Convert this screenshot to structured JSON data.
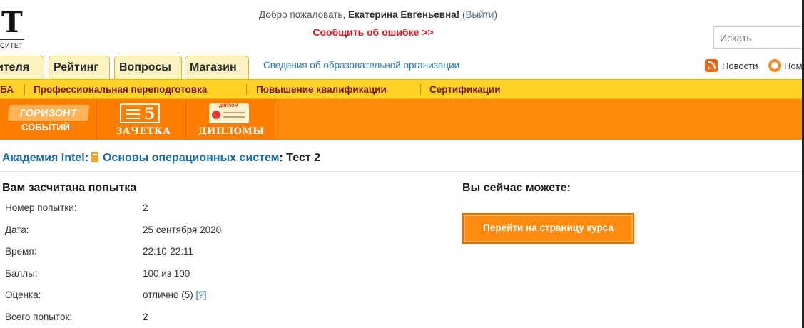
{
  "logo": {
    "letter": "T",
    "subtitle": "СИТЕТ"
  },
  "header": {
    "welcome_prefix": "Добро пожаловать, ",
    "user_name": "Екатерина Евгеньевна!",
    "logout_open": " (",
    "logout": "Выйти",
    "logout_close": ")",
    "report_error": "Сообщить об ошибке >>",
    "search_placeholder": "Искать"
  },
  "tabs": [
    {
      "label": "ителя"
    },
    {
      "label": "Рейтинг"
    },
    {
      "label": "Вопросы"
    },
    {
      "label": "Магазин"
    }
  ],
  "org_link": "Сведения об образовательной организации",
  "news_link": "Новости",
  "help_link": "Пом",
  "yellow_nav": [
    {
      "label": "БА"
    },
    {
      "label": "Профессиональная переподготовка"
    },
    {
      "label": "Повышение квалификации"
    },
    {
      "label": "Сертификации"
    }
  ],
  "banner": {
    "horizon_top": "ГОРИЗОНТ",
    "horizon_bottom": "СОБЫТИЙ",
    "zachetka_num": "5",
    "zachetka_label": "ЗАЧЕТКА",
    "diploma_icon_text": "ДИПЛОМ",
    "diplomas_label": "ДИПЛОМЫ"
  },
  "breadcrumb": {
    "academy": "Академия Intel",
    "sep1": ":",
    "course": "Основы операционных систем",
    "sep2": ":",
    "test": " Тест 2"
  },
  "result": {
    "title": "Вам засчитана попытка",
    "rows": [
      {
        "label": "Номер попытки:",
        "value": "2"
      },
      {
        "label": "Дата:",
        "value": "25 сентября 2020"
      },
      {
        "label": "Время:",
        "value": "22:10-22:11"
      },
      {
        "label": "Баллы:",
        "value": "100 из 100"
      },
      {
        "label": "Оценка:",
        "value": "отлично (5) ",
        "hint": "[?]"
      },
      {
        "label": "Всего попыток:",
        "value": "2"
      }
    ]
  },
  "actions": {
    "title": "Вы сейчас можете:",
    "course_button": "Перейти на страницу курса"
  },
  "colors": {
    "yellow_nav": "#ffd325",
    "orange_banner": "#ff8a0c",
    "link_blue": "#1b6ea8",
    "error_red": "#e0171f"
  }
}
